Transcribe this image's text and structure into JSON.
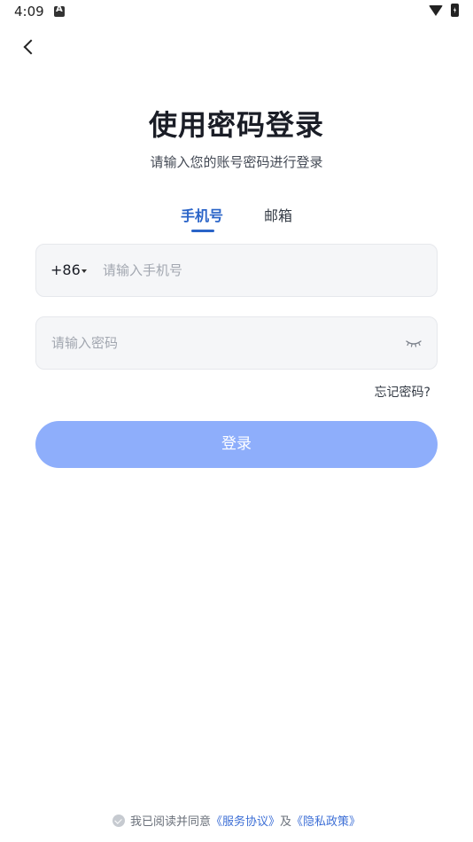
{
  "status_bar": {
    "time": "4:09"
  },
  "header": {
    "title": "使用密码登录",
    "subtitle": "请输入您的账号密码进行登录"
  },
  "tabs": [
    {
      "label": "手机号",
      "active": true
    },
    {
      "label": "邮箱",
      "active": false
    }
  ],
  "phone_field": {
    "country_code": "+86",
    "placeholder": "请输入手机号",
    "value": ""
  },
  "password_field": {
    "placeholder": "请输入密码",
    "value": ""
  },
  "forgot_password": "忘记密码?",
  "login_button": "登录",
  "agreement": {
    "prefix": "我已阅读并同意",
    "service_link": "《服务协议》",
    "conjunction": "及",
    "privacy_link": "《隐私政策》",
    "checked": false
  },
  "colors": {
    "accent": "#2a64c8",
    "button": "#8eaefb",
    "link": "#3d6fd6",
    "field_bg": "#f5f6f8"
  },
  "icons": [
    "back-icon",
    "caret-down-icon",
    "eye-closed-icon",
    "check-icon",
    "wifi-icon",
    "battery-icon"
  ]
}
